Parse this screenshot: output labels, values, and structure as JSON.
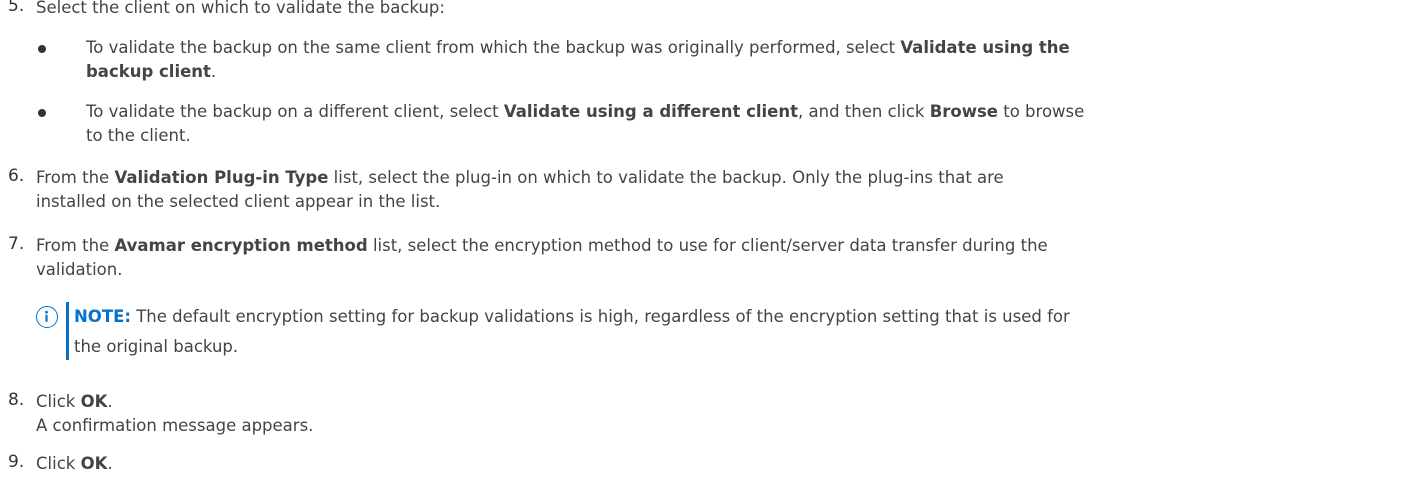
{
  "step5": {
    "number": "5.",
    "text": "Select the client on which to validate the backup:",
    "bullets": [
      {
        "line1_pre": "To validate the backup on the same client from which the backup was originally performed, select ",
        "line1_bold": "Validate using the",
        "line2_bold": "backup client",
        "line2_post": "."
      },
      {
        "line1_pre": "To validate the backup on a different client, select ",
        "line1_bold": "Validate using a different client",
        "line1_mid": ", and then click ",
        "line1_bold2": "Browse",
        "line1_post": " to browse",
        "line2": "to the client."
      }
    ]
  },
  "step6": {
    "number": "6.",
    "line1_pre": "From the ",
    "line1_bold": "Validation Plug-in Type",
    "line1_post": " list, select the plug-in on which to validate the backup. Only the plug-ins that are",
    "line2": "installed on the selected client appear in the list."
  },
  "step7": {
    "number": "7.",
    "line1_pre": "From the ",
    "line1_bold": "Avamar encryption method",
    "line1_post": " list, select the encryption method to use for client/server data transfer during the",
    "line2": "validation."
  },
  "note": {
    "icon": "info-icon",
    "label": "NOTE:",
    "line1": " The default encryption setting for backup validations is high, regardless of the encryption setting that is used for",
    "line2": "the original backup.",
    "accent_color": "#0672cb"
  },
  "step8": {
    "number": "8.",
    "line1_pre": "Click ",
    "line1_bold": "OK",
    "line1_post": ".",
    "line2": "A confirmation message appears."
  },
  "step9": {
    "number": "9.",
    "line1_pre": "Click ",
    "line1_bold": "OK",
    "line1_post": "."
  }
}
